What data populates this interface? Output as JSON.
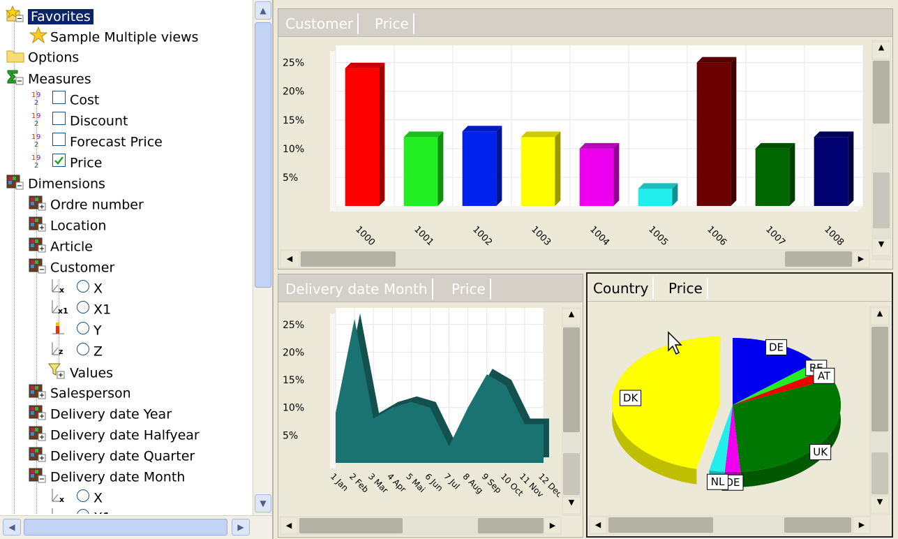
{
  "tree": {
    "favorites_label": "Favorites",
    "sample_views_label": "Sample Multiple views",
    "options_label": "Options",
    "measures_label": "Measures",
    "measures": [
      {
        "label": "Cost",
        "checked": false
      },
      {
        "label": "Discount",
        "checked": false
      },
      {
        "label": "Forecast Price",
        "checked": false
      },
      {
        "label": "Price",
        "checked": true
      }
    ],
    "dimensions_label": "Dimensions",
    "dimensions": [
      "Ordre number",
      "Location",
      "Article",
      "Customer"
    ],
    "customer_axes": [
      "X",
      "X1",
      "Y",
      "Z"
    ],
    "values_label": "Values",
    "dimensions_more": [
      "Salesperson",
      "Delivery date Year",
      "Delivery date Halfyear",
      "Delivery date Quarter",
      "Delivery date Month"
    ],
    "month_axis_x": "X",
    "month_axis_x1": "X1"
  },
  "top_panel": {
    "tab1": "Customer",
    "tab2": "Price"
  },
  "bottom_left_panel": {
    "tab1": "Delivery date Month",
    "tab2": "Price"
  },
  "bottom_right_panel": {
    "tab1": "Country",
    "tab2": "Price"
  },
  "chart_data": [
    {
      "type": "bar",
      "categories": [
        "1000",
        "1001",
        "1002",
        "1003",
        "1004",
        "1005",
        "1006",
        "1007",
        "1008"
      ],
      "values": [
        24,
        12,
        13,
        12,
        10,
        3,
        25,
        10,
        12
      ],
      "colors": [
        "#ff0000",
        "#22ee22",
        "#0022ee",
        "#ffff00",
        "#ee00ee",
        "#22eeee",
        "#6b0000",
        "#006600",
        "#000070"
      ],
      "y_ticks": [
        "5%",
        "10%",
        "15%",
        "20%",
        "25%"
      ],
      "ylim": [
        0,
        28
      ],
      "grid": true
    },
    {
      "type": "area",
      "categories": [
        "1 Jan",
        "2 Feb",
        "3 Mar",
        "4 Apr",
        "5 Mai",
        "6 Jun",
        "7 Jul",
        "8 Aug",
        "9 Sep",
        "10 Oct",
        "11 Nov",
        "12 Dec"
      ],
      "values": [
        9,
        26,
        8,
        10,
        11,
        10,
        3,
        10,
        16,
        14,
        7,
        7
      ],
      "color": "#1a7370",
      "y_ticks": [
        "5%",
        "10%",
        "15%",
        "20%",
        "25%"
      ],
      "ylim": [
        0,
        28
      ],
      "grid": true
    },
    {
      "type": "pie",
      "labels": [
        "DE",
        "BE",
        "AT",
        "UK",
        "DE",
        "NL",
        "DK"
      ],
      "values": [
        12,
        2,
        2,
        26,
        2,
        2,
        40
      ],
      "colors": [
        "#0000ee",
        "#22ee22",
        "#ee0000",
        "#007700",
        "#ee00ee",
        "#22eeee",
        "#ffff00"
      ]
    }
  ]
}
